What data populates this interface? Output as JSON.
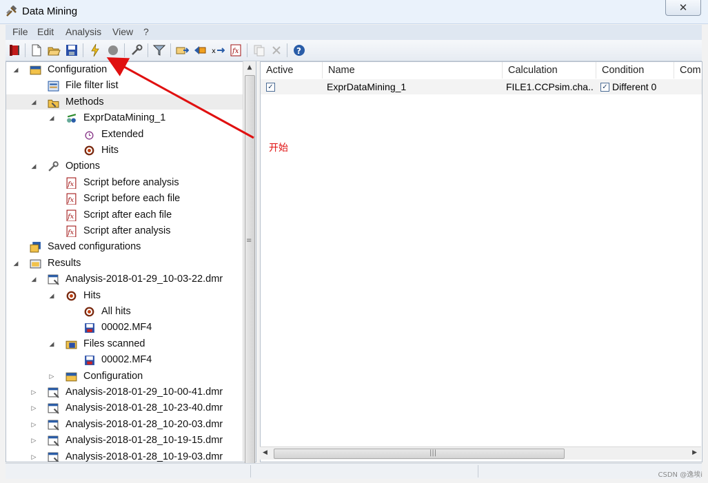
{
  "window": {
    "title": "Data Mining",
    "close_glyph": "✕"
  },
  "menu": [
    "File",
    "Edit",
    "Analysis",
    "View",
    "?"
  ],
  "toolbar": {
    "icons": [
      "exit-icon",
      "new-icon",
      "open-icon",
      "save-icon",
      "start-icon",
      "stop-icon",
      "settings-icon",
      "filter-icon",
      "export-icon",
      "import-icon",
      "variable-icon",
      "script-icon",
      "copy-icon",
      "delete-icon",
      "help-icon"
    ]
  },
  "tree": {
    "items": [
      {
        "label": "Configuration",
        "level": 0,
        "expander": "open",
        "icon": "configuration-icon"
      },
      {
        "label": "File filter list",
        "level": 1,
        "expander": "none",
        "icon": "file-filter-icon"
      },
      {
        "label": "Methods",
        "level": 1,
        "expander": "open",
        "icon": "methods-icon",
        "selected": true
      },
      {
        "label": "ExprDataMining_1",
        "level": 2,
        "expander": "open",
        "icon": "expression-icon"
      },
      {
        "label": "Extended",
        "level": 3,
        "expander": "none",
        "icon": "extended-icon"
      },
      {
        "label": "Hits",
        "level": 3,
        "expander": "none",
        "icon": "hits-icon"
      },
      {
        "label": "Options",
        "level": 1,
        "expander": "open",
        "icon": "options-icon"
      },
      {
        "label": "Script before analysis",
        "level": 2,
        "expander": "none",
        "icon": "script-icon"
      },
      {
        "label": "Script before each file",
        "level": 2,
        "expander": "none",
        "icon": "script-icon"
      },
      {
        "label": "Script after each file",
        "level": 2,
        "expander": "none",
        "icon": "script-icon"
      },
      {
        "label": "Script after analysis",
        "level": 2,
        "expander": "none",
        "icon": "script-icon"
      },
      {
        "label": "Saved configurations",
        "level": 0,
        "expander": "none",
        "icon": "saved-configurations-icon"
      },
      {
        "label": "Results",
        "level": 0,
        "expander": "open",
        "icon": "results-icon"
      },
      {
        "label": "Analysis-2018-01-29_10-03-22.dmr",
        "level": 1,
        "expander": "open",
        "icon": "analysis-file-icon"
      },
      {
        "label": "Hits",
        "level": 2,
        "expander": "open",
        "icon": "hits-icon"
      },
      {
        "label": "All hits",
        "level": 3,
        "expander": "none",
        "icon": "hits-icon"
      },
      {
        "label": "00002.MF4",
        "level": 3,
        "expander": "none",
        "icon": "mf4-file-icon"
      },
      {
        "label": "Files scanned",
        "level": 2,
        "expander": "open",
        "icon": "files-scanned-icon"
      },
      {
        "label": "00002.MF4",
        "level": 3,
        "expander": "none",
        "icon": "mf4-file-icon"
      },
      {
        "label": "Configuration",
        "level": 2,
        "expander": "closed",
        "icon": "configuration-icon"
      },
      {
        "label": "Analysis-2018-01-29_10-00-41.dmr",
        "level": 1,
        "expander": "closed",
        "icon": "analysis-file-icon"
      },
      {
        "label": "Analysis-2018-01-28_10-23-40.dmr",
        "level": 1,
        "expander": "closed",
        "icon": "analysis-file-icon"
      },
      {
        "label": "Analysis-2018-01-28_10-20-03.dmr",
        "level": 1,
        "expander": "closed",
        "icon": "analysis-file-icon"
      },
      {
        "label": "Analysis-2018-01-28_10-19-15.dmr",
        "level": 1,
        "expander": "closed",
        "icon": "analysis-file-icon"
      },
      {
        "label": "Analysis-2018-01-28_10-19-03.dmr",
        "level": 1,
        "expander": "closed",
        "icon": "analysis-file-icon"
      }
    ]
  },
  "list": {
    "columns": [
      "Active",
      "Name",
      "Calculation",
      "Condition",
      "Com"
    ],
    "rows": [
      {
        "active": true,
        "name": "ExprDataMining_1",
        "calculation": "FILE1.CCPsim.cha...",
        "condition_checked": true,
        "condition": "Different 0"
      }
    ]
  },
  "annotation": {
    "text": "开始",
    "color": "#e01010"
  },
  "watermark": "CSDN @逸埃i",
  "colors": {
    "accent": "#2a5da8",
    "annotation": "#e01010"
  }
}
